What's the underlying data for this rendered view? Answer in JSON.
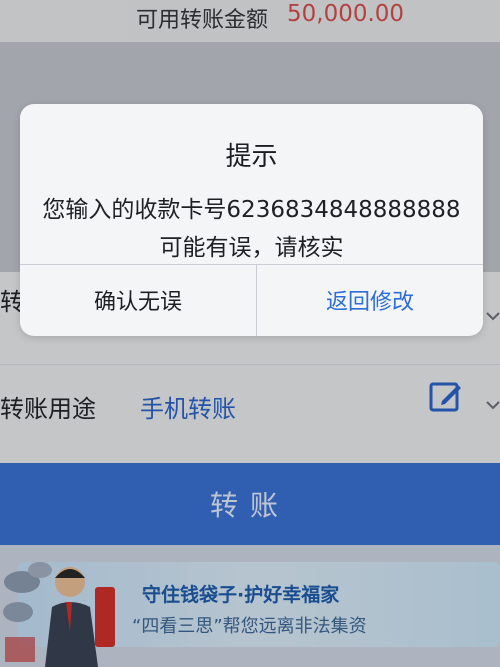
{
  "top": {
    "label": "可用转账金额",
    "amount": "50,000.00"
  },
  "purpose_row": {
    "label": "转账用途",
    "value": "手机转账"
  },
  "partial_row_label": "转",
  "transfer_button": "转账",
  "banner": {
    "title": "守住钱袋子·护好幸福家",
    "subtitle": "“四看三思”帮您远离非法集资"
  },
  "dialog": {
    "title": "提示",
    "message_line1": "您输入的收款卡号6236834848888888",
    "message_line2": "可能有误，请核实",
    "confirm_label": "确认无误",
    "back_label": "返回修改"
  },
  "colors": {
    "accent": "#3b74d9",
    "amount": "#e14a45",
    "link": "#2d6ed6"
  }
}
